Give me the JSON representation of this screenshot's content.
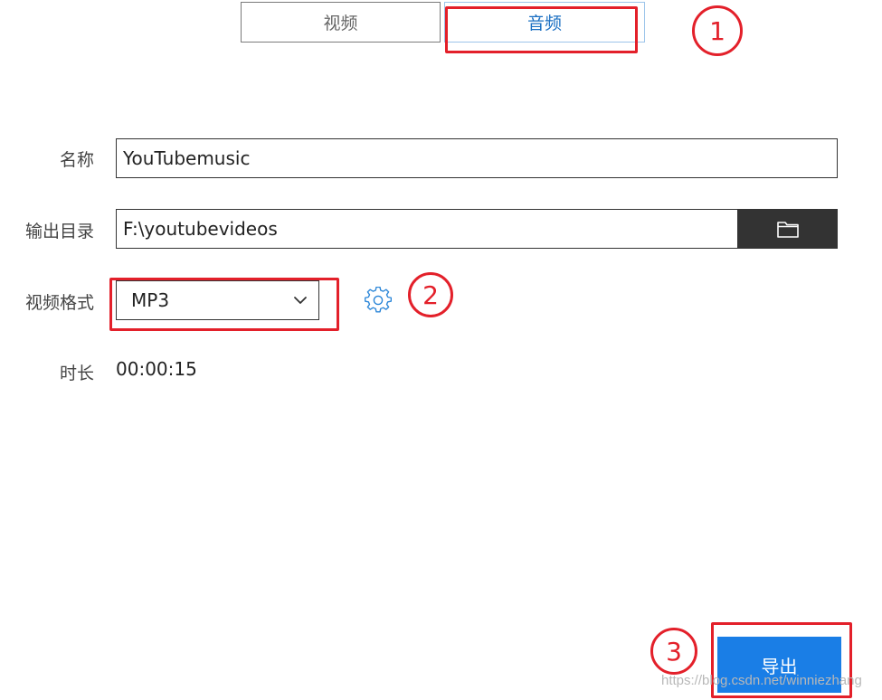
{
  "tabs": [
    {
      "label": "视频",
      "selected": false
    },
    {
      "label": "音频",
      "selected": true
    }
  ],
  "form": {
    "name_label": "名称",
    "name_value": "YouTubemusic",
    "output_dir_label": "输出目录",
    "output_dir_value": "F:\\youtubevideos",
    "format_label": "视频格式",
    "format_value": "MP3",
    "duration_label": "时长",
    "duration_value": "00:00:15"
  },
  "actions": {
    "export_label": "导出"
  },
  "icons": {
    "folder": "folder-icon",
    "chevron": "chevron-down-icon",
    "settings": "gear-icon"
  },
  "annotations": {
    "step1": "1",
    "step2": "2",
    "step3": "3"
  },
  "watermark": "https://blog.csdn.net/winniezhang",
  "colors": {
    "accent_blue": "#1a7ee6",
    "annotation_red": "#e3202a",
    "dark_button": "#333333"
  }
}
